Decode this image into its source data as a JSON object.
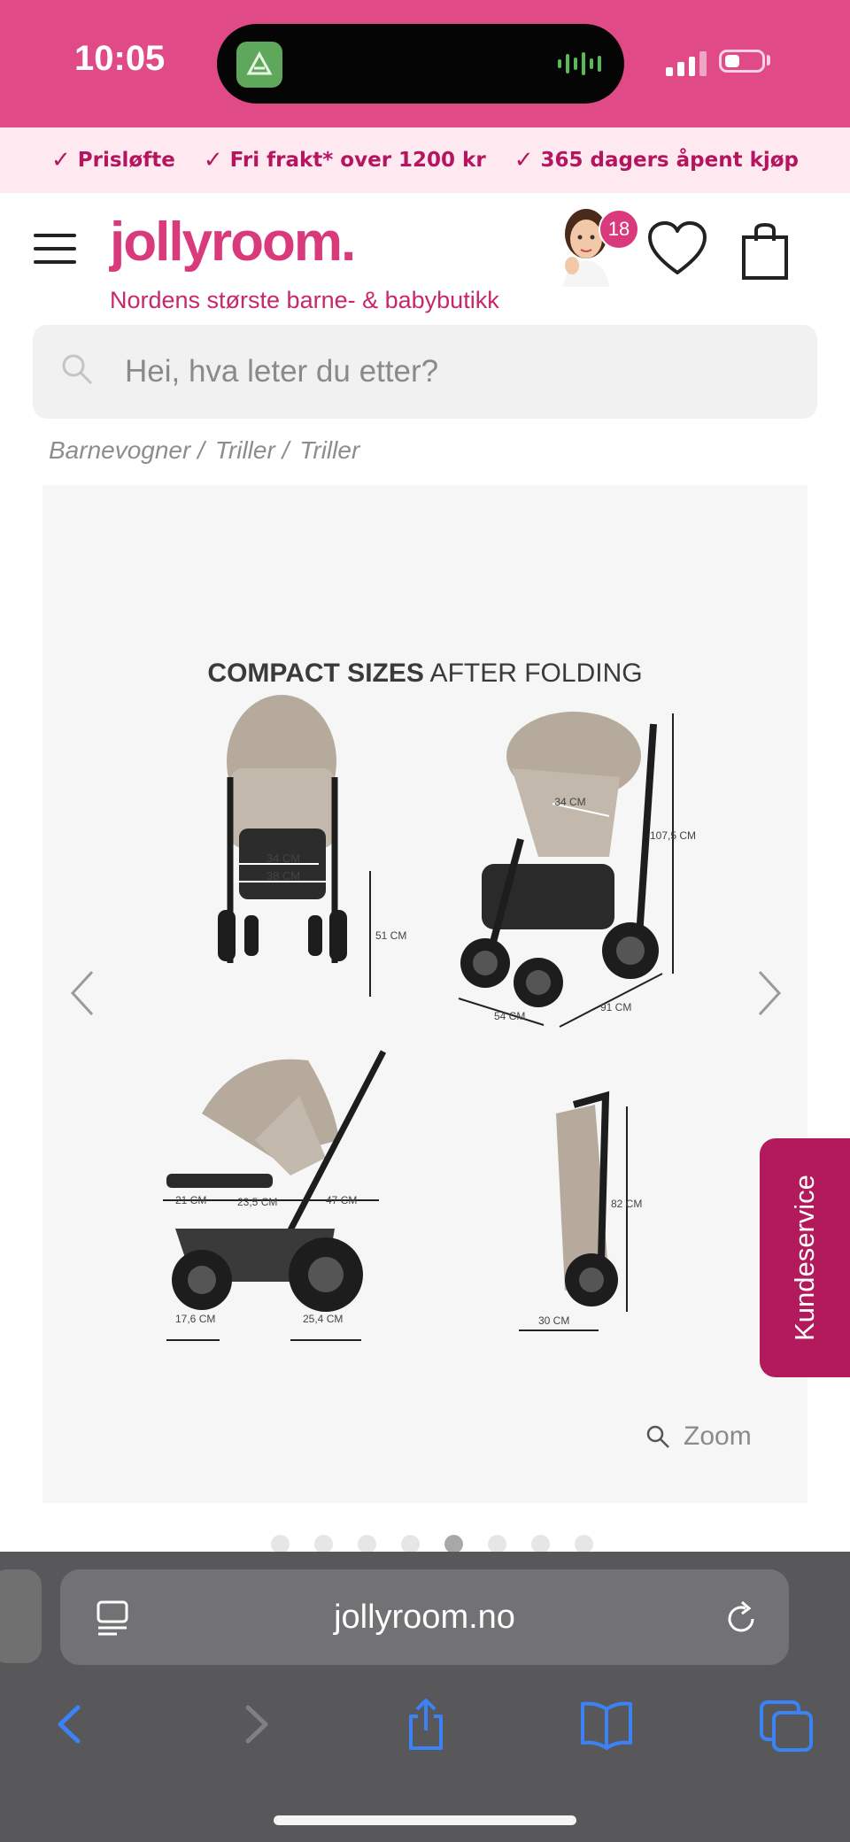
{
  "status_bar": {
    "time": "10:05"
  },
  "promo": {
    "items": [
      "Prisløfte",
      "Fri frakt* over 1200 kr",
      "365 dagers åpent kjøp"
    ]
  },
  "header": {
    "logo": "jollyroom.",
    "tagline": "Nordens største barne- & babybutikk",
    "avatar_badge": "18",
    "brand_color": "#d93a7c"
  },
  "search": {
    "placeholder": "Hei, hva leter du etter?"
  },
  "breadcrumb": {
    "items": [
      "Barnevogner /",
      "Triller /",
      "Triller"
    ]
  },
  "gallery": {
    "title_bold": "COMPACT SIZES",
    "title_rest": " AFTER FOLDING",
    "dimensions": {
      "width_inner": "34 CM",
      "width_outer": "38 CM",
      "seat_height": "51 CM",
      "backrest_width": "34 CM",
      "total_height": "107,5 CM",
      "depth_54": "54 CM",
      "length": "91 CM",
      "footrest": "21 CM",
      "seat_depth": "23,5 CM",
      "backrest": "47 CM",
      "front_wheel": "17,6 CM",
      "rear_wheel": "25,4 CM",
      "folded_height": "82 CM",
      "folded_width": "30 CM"
    },
    "zoom_label": "Zoom",
    "slide_count": 8,
    "active_slide": 5
  },
  "kundeservice": "Kundeservice",
  "browser": {
    "url": "jollyroom.no",
    "accent": "#3b82f6"
  }
}
